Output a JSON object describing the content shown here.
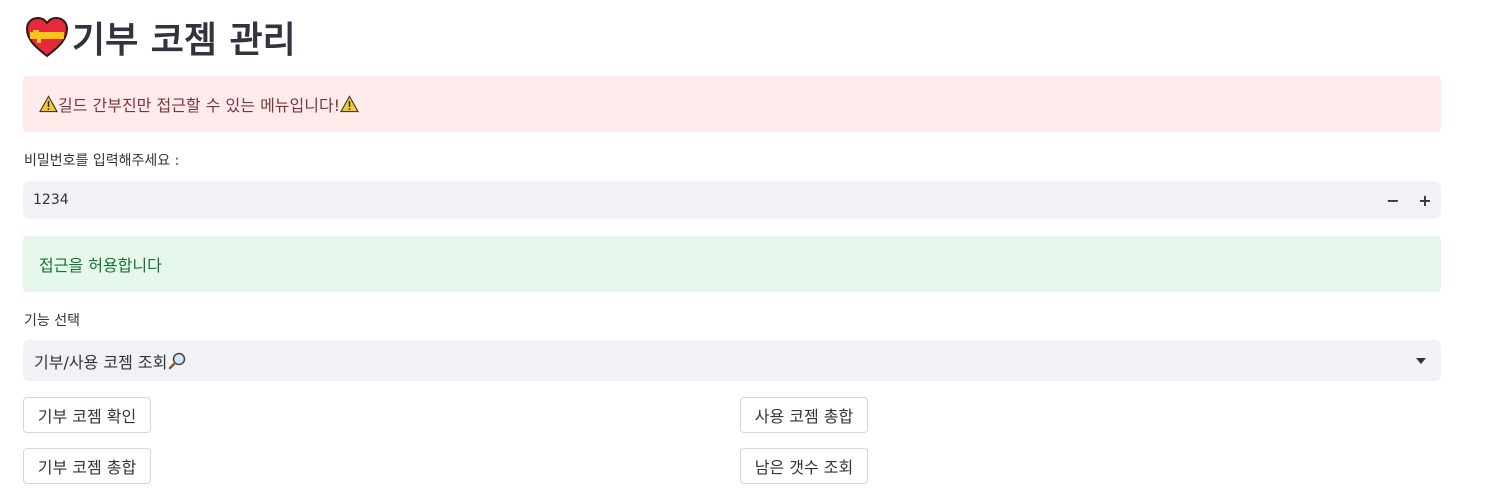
{
  "header": {
    "title": "기부 코젬 관리",
    "icon": "heart-icon"
  },
  "warning": {
    "text": "길드 간부진만 접근할 수 있는 메뉴입니다!",
    "icon": "warning-icon"
  },
  "password": {
    "label": "비밀번호를 입력해주세요 :",
    "value": "1234",
    "decrement_label": "−",
    "increment_label": "+"
  },
  "success": {
    "text": "접근을 허용합니다"
  },
  "function_select": {
    "label": "기능 선택",
    "selected": "기부/사용 코젬 조회",
    "icon": "magnifier-icon"
  },
  "buttons": {
    "check_donation": "기부 코젬 확인",
    "total_used": "사용 코젬 총합",
    "total_donation": "기부 코젬 총합",
    "remaining_count": "남은 갯수 조회"
  },
  "colors": {
    "warning_bg": "#ffebec",
    "success_bg": "#e6f8ec",
    "input_bg": "#f0f2f6"
  }
}
